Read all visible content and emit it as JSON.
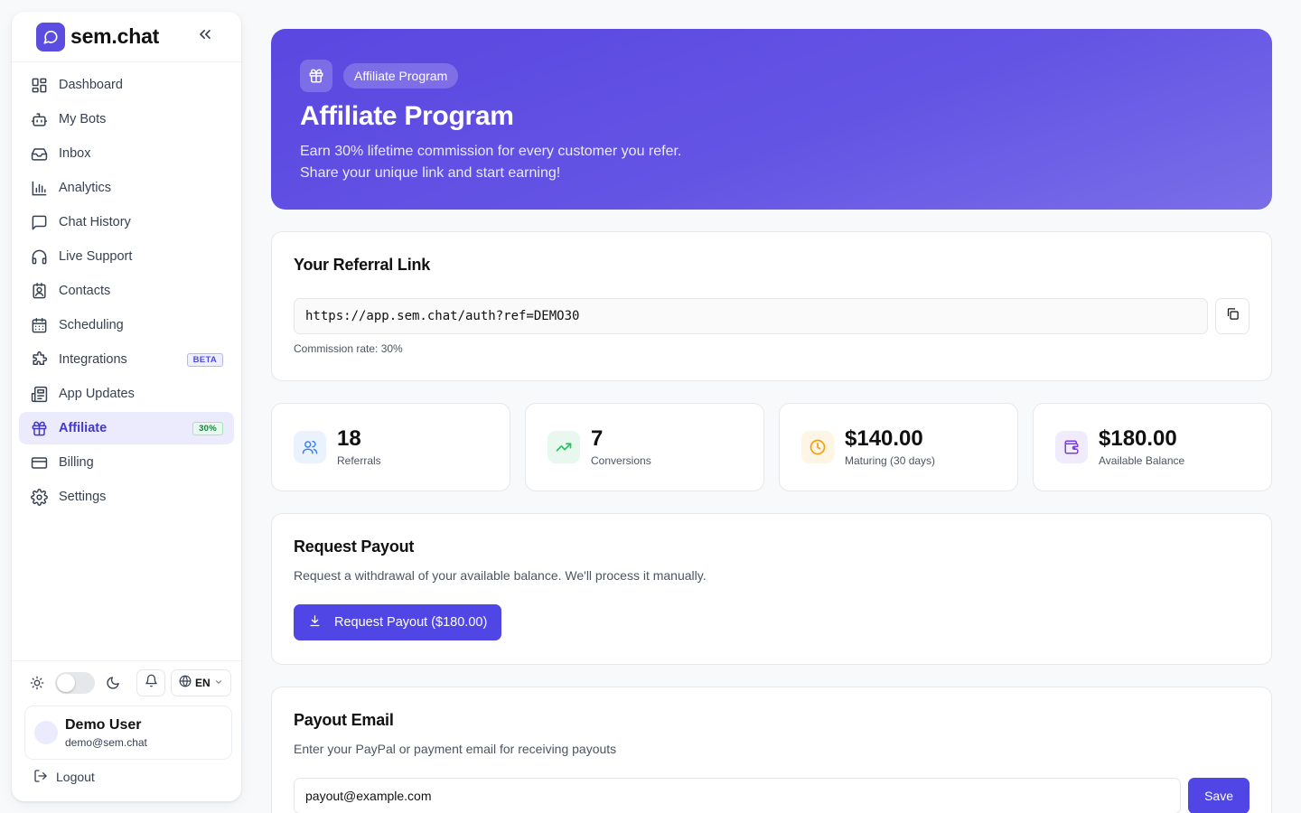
{
  "brand": {
    "name": "sem.chat",
    "logo_icon": "chat-bubble-icon",
    "accent": "#5b4de0"
  },
  "sidebar": {
    "items": [
      {
        "label": "Dashboard",
        "icon": "dashboard-icon"
      },
      {
        "label": "My Bots",
        "icon": "bot-icon"
      },
      {
        "label": "Inbox",
        "icon": "inbox-icon"
      },
      {
        "label": "Analytics",
        "icon": "bar-chart-icon"
      },
      {
        "label": "Chat History",
        "icon": "message-square-icon"
      },
      {
        "label": "Live Support",
        "icon": "headphones-icon"
      },
      {
        "label": "Contacts",
        "icon": "contacts-icon"
      },
      {
        "label": "Scheduling",
        "icon": "calendar-icon"
      },
      {
        "label": "Integrations",
        "icon": "puzzle-icon",
        "badge": "BETA"
      },
      {
        "label": "App Updates",
        "icon": "newspaper-icon"
      },
      {
        "label": "Affiliate",
        "icon": "gift-icon",
        "badge": "30%",
        "active": true
      },
      {
        "label": "Billing",
        "icon": "credit-card-icon"
      },
      {
        "label": "Settings",
        "icon": "gear-icon"
      }
    ],
    "language": "EN",
    "user": {
      "name": "Demo User",
      "email": "demo@sem.chat"
    },
    "logout_label": "Logout"
  },
  "hero": {
    "pill": "Affiliate Program",
    "title": "Affiliate Program",
    "subtitle_line1": "Earn 30% lifetime commission for every customer you refer.",
    "subtitle_line2": "Share your unique link and start earning!"
  },
  "referral": {
    "title": "Your Referral Link",
    "link": "https://app.sem.chat/auth?ref=DEMO30",
    "note": "Commission rate: 30%"
  },
  "stats": [
    {
      "value": "18",
      "label": "Referrals",
      "icon": "users-icon",
      "color": "#3b82f6",
      "bg": "#eaf2fe"
    },
    {
      "value": "7",
      "label": "Conversions",
      "icon": "trending-up-icon",
      "color": "#22c55e",
      "bg": "#e8f8ee"
    },
    {
      "value": "$140.00",
      "label": "Maturing (30 days)",
      "icon": "clock-icon",
      "color": "#f59e0b",
      "bg": "#fef5e4"
    },
    {
      "value": "$180.00",
      "label": "Available Balance",
      "icon": "wallet-icon",
      "color": "#7c3aed",
      "bg": "#f1ecfd"
    }
  ],
  "payout": {
    "title": "Request Payout",
    "description": "Request a withdrawal of your available balance. We'll process it manually.",
    "button_label": "Request Payout ($180.00)"
  },
  "payout_email": {
    "title": "Payout Email",
    "description": "Enter your PayPal or payment email for receiving payouts",
    "value": "payout@example.com",
    "save_label": "Save"
  }
}
